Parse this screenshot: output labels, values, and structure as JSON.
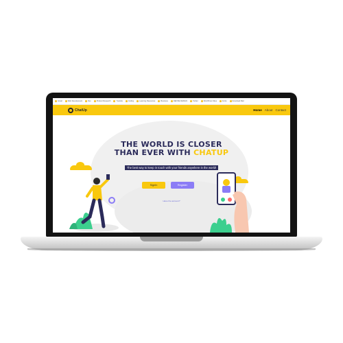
{
  "bookmarks": [
    {
      "label": "Gmail"
    },
    {
      "label": "Web Development"
    },
    {
      "label": "Dev"
    },
    {
      "label": "Product Research"
    },
    {
      "label": "Youtube"
    },
    {
      "label": "Coding"
    },
    {
      "label": "Learning Resources"
    },
    {
      "label": "Business"
    },
    {
      "label": "DEFINE DESIGN"
    },
    {
      "label": "Twitter"
    },
    {
      "label": "WordPress Sites"
    },
    {
      "label": "Fonts"
    },
    {
      "label": "Download Mail"
    }
  ],
  "nav": {
    "logo_text": "ChatUp",
    "links": [
      "Home",
      "About",
      "Contact"
    ]
  },
  "hero": {
    "headline_line1": "THE WORLD IS CLOSER",
    "headline_line2_prefix": "THAN EVER WITH ",
    "headline_line2_accent": "CHATUP",
    "tagline": "The best way to keep in touch with your friends anywhere in the world!",
    "signin_label": "SignIn",
    "register_label": "Register",
    "small_link": "Have the account?"
  },
  "colors": {
    "brand_yellow": "#f9c80e",
    "navy": "#2b2b5a",
    "purple": "#8b7cf6"
  }
}
